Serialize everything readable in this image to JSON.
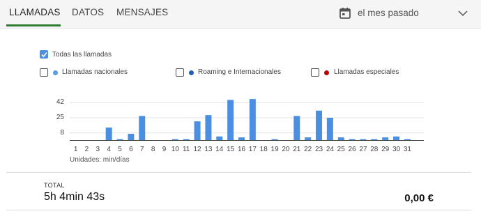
{
  "tabs": [
    {
      "label": "LLAMADAS"
    },
    {
      "label": "DATOS"
    },
    {
      "label": "MENSAJES"
    }
  ],
  "period": {
    "label": "el mes pasado"
  },
  "filters": {
    "all": {
      "label": "Todas las llamadas",
      "checked": true
    },
    "items": [
      {
        "label": "Llamadas nacionales",
        "color": "#5b9be0",
        "checked": false
      },
      {
        "label": "Roaming e Internacionales",
        "color": "#1f5fb0",
        "checked": false
      },
      {
        "label": "Llamadas especiales",
        "color": "#c00000",
        "checked": false
      }
    ]
  },
  "colors": {
    "bar": "#4a8fe0",
    "accent": "#2e7d32"
  },
  "chart_data": {
    "type": "bar",
    "categories": [
      "1",
      "2",
      "3",
      "4",
      "5",
      "6",
      "7",
      "8",
      "9",
      "10",
      "11",
      "12",
      "13",
      "14",
      "15",
      "16",
      "17",
      "18",
      "19",
      "20",
      "21",
      "22",
      "23",
      "24",
      "25",
      "26",
      "27",
      "28",
      "29",
      "30",
      "31"
    ],
    "values": [
      0,
      0,
      0,
      14,
      1,
      7,
      27,
      0,
      0,
      1,
      1,
      21,
      28,
      4,
      45,
      3,
      46,
      0,
      0.5,
      0,
      27,
      3,
      33,
      25,
      3,
      1,
      1,
      1,
      3,
      4,
      1
    ],
    "yticks": [
      "8",
      "25",
      "42"
    ],
    "ylim": [
      0,
      50
    ],
    "units": "Unidades: min/días"
  },
  "total": {
    "label": "TOTAL",
    "value": "5h 4min 43s",
    "price": "0,00 €"
  }
}
